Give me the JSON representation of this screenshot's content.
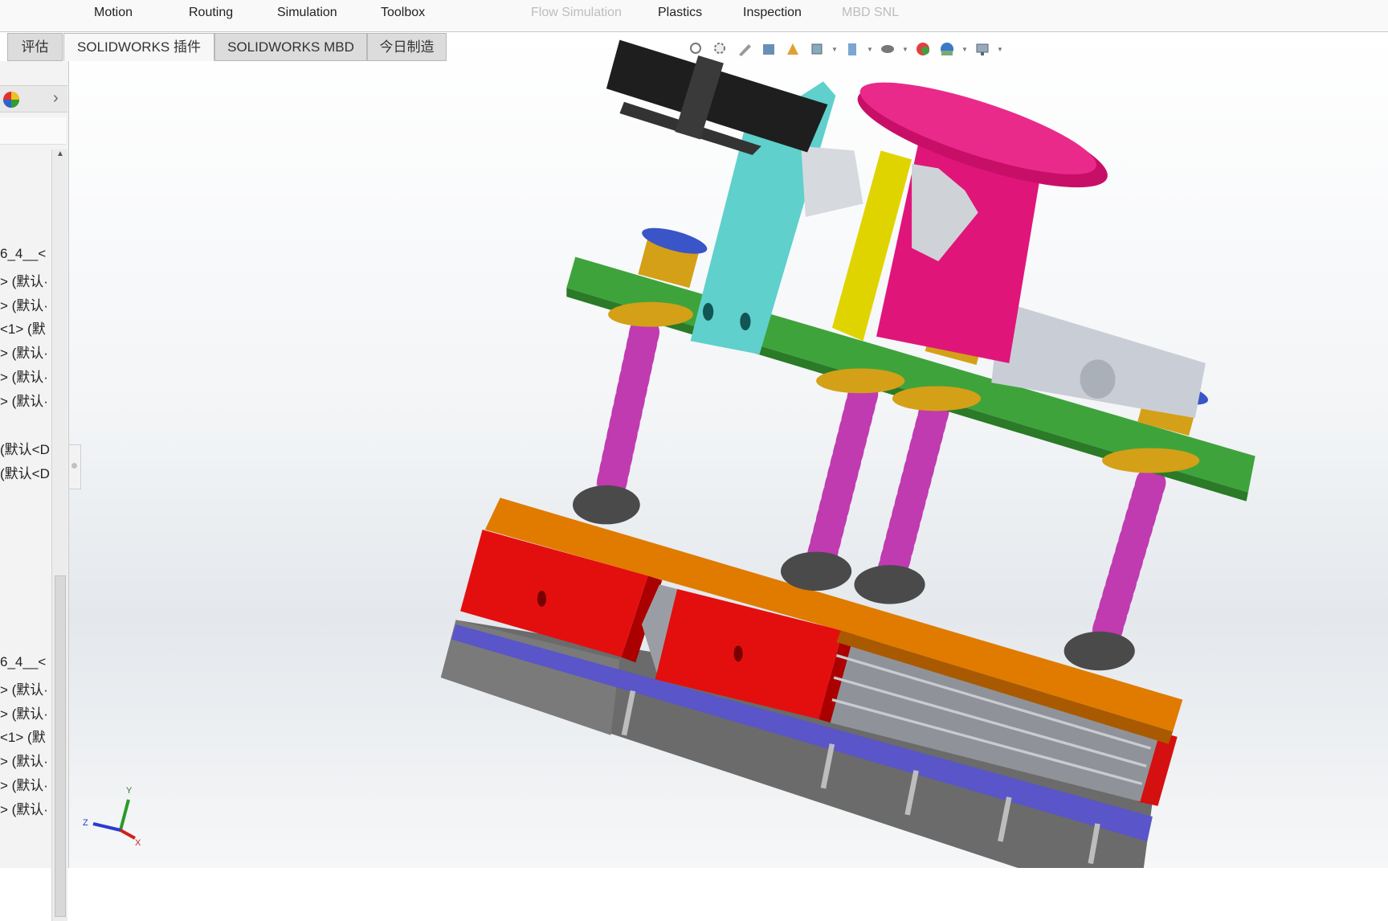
{
  "menubar": {
    "items": [
      {
        "label": "Motion",
        "disabled": false
      },
      {
        "label": "Routing",
        "disabled": false
      },
      {
        "label": "Simulation",
        "disabled": false
      },
      {
        "label": "Toolbox",
        "disabled": false
      },
      {
        "label": "Flow Simulation",
        "disabled": true
      },
      {
        "label": "Plastics",
        "disabled": false
      },
      {
        "label": "Inspection",
        "disabled": false
      },
      {
        "label": "MBD SNL",
        "disabled": true
      }
    ]
  },
  "tabs": [
    {
      "label": "评估",
      "active": false
    },
    {
      "label": "SOLIDWORKS 插件",
      "active": true
    },
    {
      "label": "SOLIDWORKS MBD",
      "active": false
    },
    {
      "label": "今日制造",
      "active": false
    }
  ],
  "left_panel": {
    "expand_label": "›",
    "tree_items": [
      "6_4__<",
      "> (默认·",
      "> (默认·",
      "<1> (默",
      "> (默认·",
      "> (默认·",
      "> (默认·",
      "(默认<D",
      "(默认<D",
      "6_4__<",
      "> (默认·",
      "> (默认·",
      "<1> (默",
      "> (默认·",
      "> (默认·",
      "> (默认·"
    ]
  },
  "heads_up_toolbar": {
    "icons": [
      "zoom-to-fit-icon",
      "zoom-area-icon",
      "previous-view-icon",
      "section-view-icon",
      "dynamic-annotation-icon",
      "view-orientation-icon",
      "display-style-icon",
      "hide-show-icon",
      "edit-appearance-icon",
      "apply-scene-icon",
      "view-settings-icon"
    ]
  },
  "triad": {
    "x": "X",
    "y": "Y",
    "z": "Z"
  },
  "colors": {
    "accent_green": "#3fa33c",
    "magenta": "#e0157a",
    "cyan": "#5fd0cc",
    "red": "#e01010",
    "orange": "#e07b00",
    "purple": "#5555cc"
  }
}
